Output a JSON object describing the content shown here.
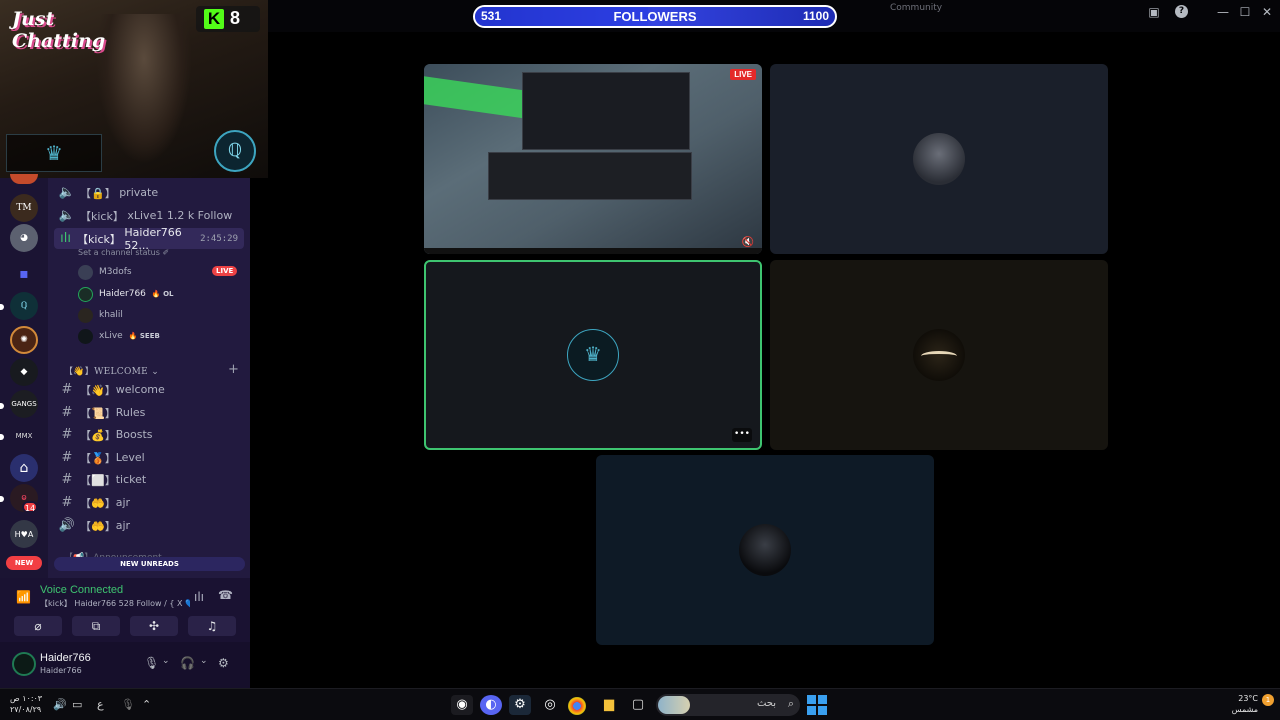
{
  "window": {
    "title": "Community",
    "controls": {
      "inbox_icon": "inbox-icon",
      "help": "?",
      "minimize": "—",
      "maximize": "☐",
      "close": "✕"
    }
  },
  "followers_goal": {
    "current": "531",
    "label": "FOLLOWERS",
    "goal": "1100",
    "progress": 0.48
  },
  "stream_overlay": {
    "category": "Just Chatting",
    "kick_logo": "K",
    "kick_count": "8"
  },
  "servers": {
    "mention_count": "14",
    "new_badge": "NEW",
    "labels": [
      "TM",
      "H♥A"
    ]
  },
  "channels": {
    "voice_items": [
      {
        "prefix": "【🔒】",
        "name": "private"
      },
      {
        "prefix": "【kick】",
        "name": "xLive1 1.2 k Follow"
      },
      {
        "prefix": "【kick】",
        "name": "Haider766 52...",
        "time": "2:45:29"
      }
    ],
    "status_hint": "Set a channel status ✐",
    "voice_users": [
      {
        "name": "M3dofs",
        "badge": "LIVE"
      },
      {
        "name": "Haider766",
        "tag": "🔥 OL"
      },
      {
        "name": "khalil",
        "tag": ""
      },
      {
        "name": "xLive",
        "tag": "🔥 SEEB"
      }
    ],
    "category_welcome": "【👋】WELCOME ⌄",
    "text_items": [
      {
        "glyph": "#",
        "prefix": "【👋】",
        "name": "welcome"
      },
      {
        "glyph": "#",
        "prefix": "【📜】",
        "name": "Rules"
      },
      {
        "glyph": "#",
        "prefix": "【💰】",
        "name": "Boosts"
      },
      {
        "glyph": "#",
        "prefix": "【🥉】",
        "name": "Level"
      },
      {
        "glyph": "#",
        "prefix": "【⬜】",
        "name": "ticket"
      },
      {
        "glyph": "#",
        "prefix": "【🤲】",
        "name": "ajr"
      },
      {
        "glyph": "🔊",
        "prefix": "【🤲】",
        "name": "ajr"
      }
    ],
    "category_announce": "【📢】Announcement",
    "new_unreads": "NEW UNREADS"
  },
  "voice_panel": {
    "title": "Voice Connected",
    "subtitle": "【kick】 Haider766 528 Follow / { X 💙...",
    "buttons": [
      "camera-off-icon",
      "screen-share-icon",
      "activities-icon",
      "soundboard-icon"
    ]
  },
  "user_panel": {
    "name": "Haider766",
    "status": "Haider766"
  },
  "screen_share": {
    "live_badge": "LIVE"
  },
  "taskbar": {
    "time": "١٠:٠٣ ص",
    "date": "٢٧/٠٨/٢٩",
    "lang": "ع",
    "search_placeholder": "بحث",
    "weather_temp": "23°C",
    "weather_desc": "مشمس",
    "weather_badge": "1"
  },
  "colors": {
    "accent_green": "#3ec470",
    "followers_blue": "#2f3fd8",
    "kick_green": "#53fc18",
    "danger": "#ed4245"
  }
}
